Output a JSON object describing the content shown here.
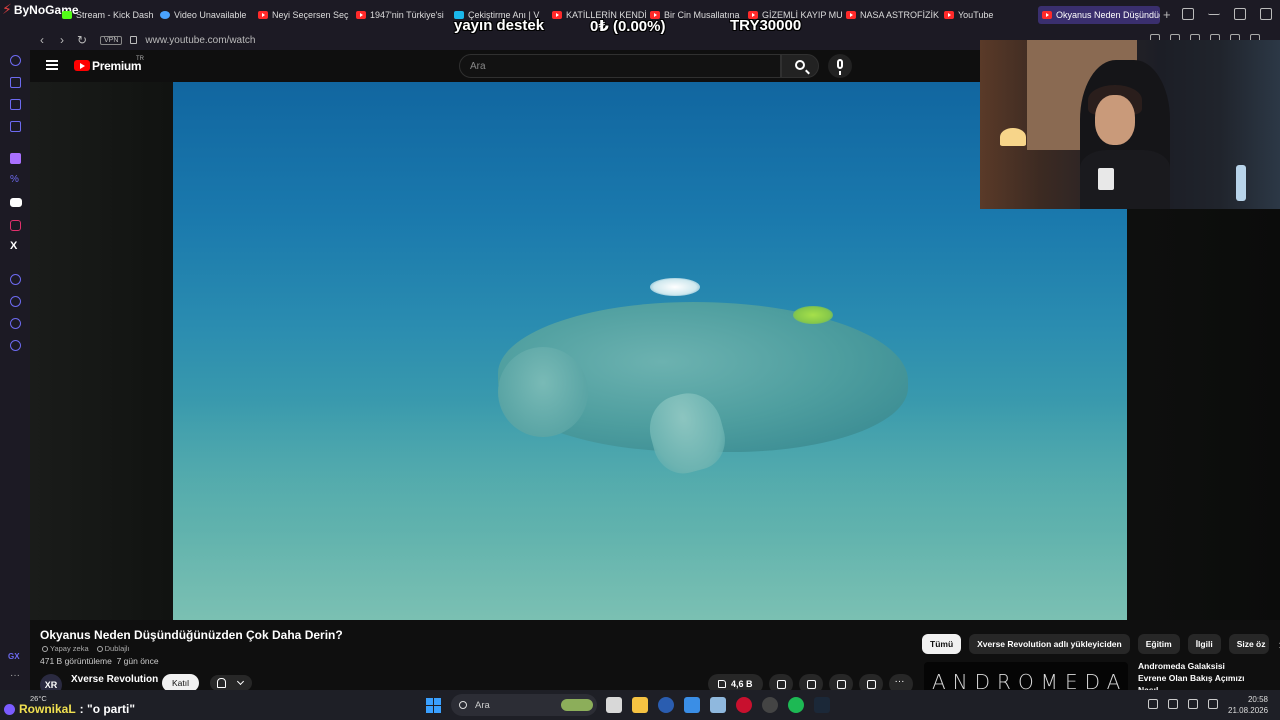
{
  "stream_brand": "ByNoGame",
  "browser": {
    "tabs": [
      {
        "label": "Stream - Kick Dash",
        "icon": "kick-icon"
      },
      {
        "label": "Video Unavailable",
        "icon": "gx-icon"
      },
      {
        "label": "Neyi Seçersen Seç",
        "icon": "youtube-icon"
      },
      {
        "label": "1947'nin Türkiye'si",
        "icon": "youtube-icon"
      },
      {
        "label": "Çekiştirme Anı | V",
        "icon": "vimeo-icon"
      },
      {
        "label": "KATİLLERİN KENDİ",
        "icon": "youtube-icon"
      },
      {
        "label": "Bir Cin Musallatına",
        "icon": "youtube-icon"
      },
      {
        "label": "GİZEMLİ KAYIP MU",
        "icon": "youtube-icon"
      },
      {
        "label": "NASA ASTROFİZİK",
        "icon": "youtube-icon"
      },
      {
        "label": "YouTube",
        "icon": "youtube-icon"
      },
      {
        "label": "Okyanus Neden Düşündüğ",
        "icon": "youtube-icon",
        "active": true
      }
    ],
    "vpn_label": "VPN",
    "url": "www.youtube.com/watch"
  },
  "overlay": {
    "label": "yayın destek",
    "progress": "0₺ (0.00%)",
    "goal": "TRY30000"
  },
  "youtube": {
    "logo_text": "Premium",
    "region": "TR",
    "search_placeholder": "Ara",
    "video": {
      "title": "Okyanus Neden Düşündüğünüzden Çok Daha Derin?",
      "tag_ai": "Yapay zeka",
      "tag_dubbed": "Dublajlı",
      "views": "471 B görüntüleme",
      "uploaded": "7 gün önce",
      "channel": "Xverse Revolution",
      "channel_initials": "XR",
      "join_label": "Katıl",
      "likes": "4,6 B"
    },
    "chips": [
      {
        "label": "Tümü",
        "active": true
      },
      {
        "label": "Xverse Revolution adlı yükleyiciden"
      },
      {
        "label": "Eğitim"
      },
      {
        "label": "İlgili"
      },
      {
        "label": "Size öz"
      }
    ],
    "recommendation": {
      "thumb_text": "ANDROMEDA",
      "title": "Andromeda Galaksisi Evrene Olan Bakış Açımızı Nasıl"
    }
  },
  "taskbar": {
    "temperature": "26°C",
    "chat_user": "RownikaL",
    "chat_message": ": \"o parti\"",
    "search_label": "Ara",
    "time": "20:58",
    "date": "21.08.2026"
  }
}
